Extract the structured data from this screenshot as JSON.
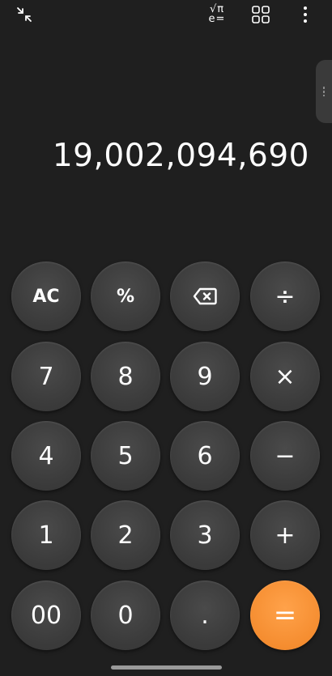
{
  "display": {
    "value": "19,002,094,690"
  },
  "toolbar": {
    "sci_top": "√π",
    "sci_bottom": "e="
  },
  "keys": {
    "ac": "AC",
    "percent": "%",
    "divide": "÷",
    "seven": "7",
    "eight": "8",
    "nine": "9",
    "multiply": "×",
    "four": "4",
    "five": "5",
    "six": "6",
    "minus": "−",
    "one": "1",
    "two": "2",
    "three": "3",
    "plus": "+",
    "double_zero": "00",
    "zero": "0",
    "decimal": ".",
    "equals": "="
  },
  "colors": {
    "background": "#1f1f1f",
    "key": "#3c3c3c",
    "equals": "#f58d30"
  }
}
